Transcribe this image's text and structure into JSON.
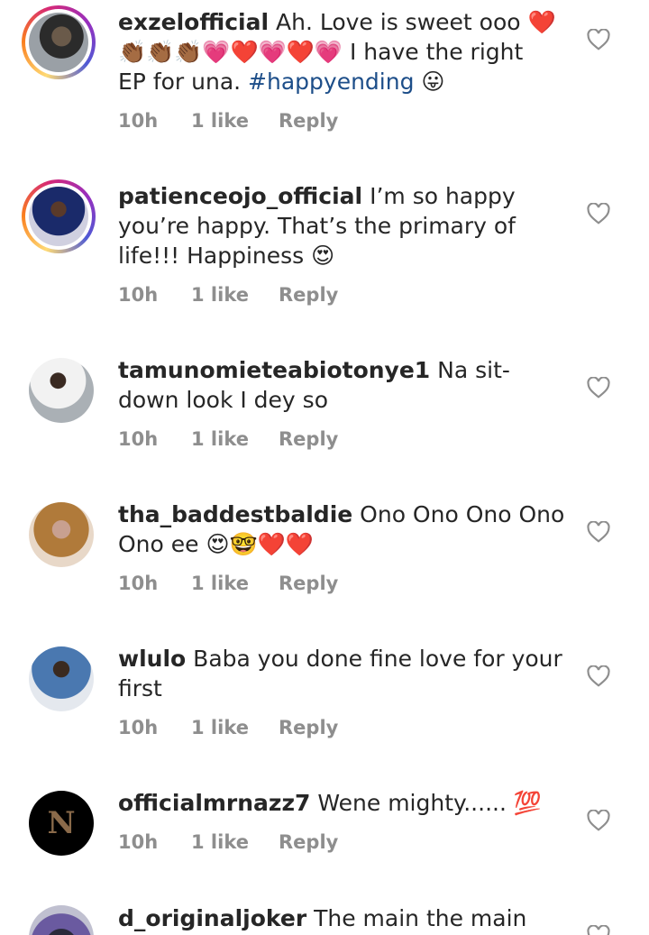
{
  "comments": [
    {
      "username": "exzelofficial",
      "text_parts": [
        "Ah. Love is sweet ooo ❤️",
        "👏🏾👏🏾👏🏾💗❤️💗❤️💗 I have the right",
        "EP for una. "
      ],
      "hashtag": "#happyending",
      "after_hashtag": " 😛",
      "time": "10h",
      "likes": "1 like",
      "reply": "Reply"
    },
    {
      "username": "patienceojo_official",
      "text": " I’m so happy you’re happy. That’s the primary of life!!! Happiness 😍",
      "time": "10h",
      "likes": "1 like",
      "reply": "Reply"
    },
    {
      "username": "tamunomieteabiotonye1",
      "text": " Na sit-down look I dey so",
      "time": "10h",
      "likes": "1 like",
      "reply": "Reply"
    },
    {
      "username": "tha_baddestbaldie",
      "text": " Ono Ono Ono Ono Ono ee 😍🤓❤️❤️",
      "time": "10h",
      "likes": "1 like",
      "reply": "Reply"
    },
    {
      "username": "wlulo",
      "text": " Baba you done fine love for your first",
      "time": "10h",
      "likes": "1 like",
      "reply": "Reply"
    },
    {
      "username": "officialmrnazz7",
      "text": " Wene mighty...... 💯",
      "time": "10h",
      "likes": "1 like",
      "reply": "Reply"
    },
    {
      "username": "d_originaljoker",
      "text": " The main the main  boss",
      "time": "",
      "likes": "",
      "reply": ""
    }
  ],
  "colors": {
    "text": "#262626",
    "meta": "#8e8e8e",
    "hashtag": "#1d4e89",
    "heart_outline": "#8e8e8e"
  },
  "icons": {
    "like": "heart-outline-icon"
  }
}
